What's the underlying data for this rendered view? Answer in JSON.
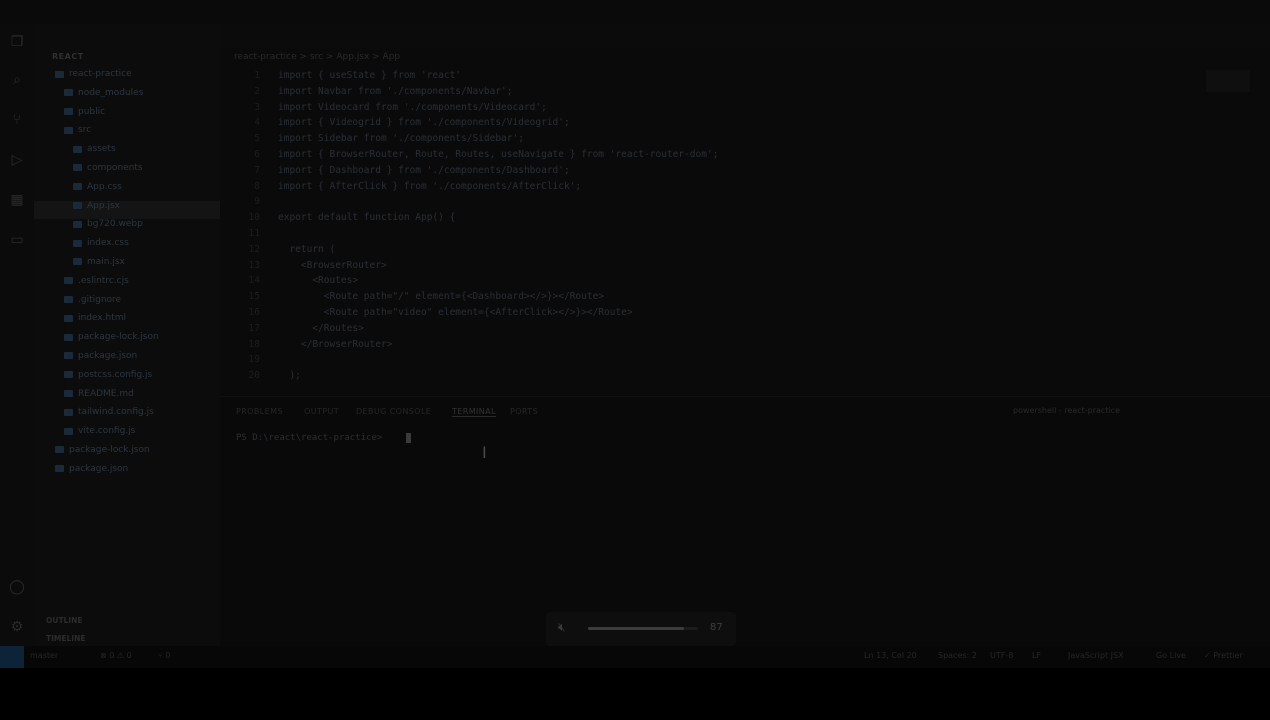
{
  "sidebar": {
    "header": "REACT",
    "tree": [
      {
        "label": "react-practice",
        "indent": 1
      },
      {
        "label": "node_modules",
        "indent": 2
      },
      {
        "label": "public",
        "indent": 2
      },
      {
        "label": "src",
        "indent": 2
      },
      {
        "label": "assets",
        "indent": 3
      },
      {
        "label": "components",
        "indent": 3
      },
      {
        "label": "App.css",
        "indent": 3
      },
      {
        "label": "App.jsx",
        "indent": 3,
        "selected": true
      },
      {
        "label": "bg720.webp",
        "indent": 3
      },
      {
        "label": "index.css",
        "indent": 3
      },
      {
        "label": "main.jsx",
        "indent": 3
      },
      {
        "label": ".eslintrc.cjs",
        "indent": 2
      },
      {
        "label": ".gitignore",
        "indent": 2
      },
      {
        "label": "index.html",
        "indent": 2
      },
      {
        "label": "package-lock.json",
        "indent": 2
      },
      {
        "label": "package.json",
        "indent": 2
      },
      {
        "label": "postcss.config.js",
        "indent": 2
      },
      {
        "label": "README.md",
        "indent": 2
      },
      {
        "label": "tailwind.config.js",
        "indent": 2
      },
      {
        "label": "vite.config.js",
        "indent": 2
      },
      {
        "label": "package-lock.json",
        "indent": 1
      },
      {
        "label": "package.json",
        "indent": 1
      }
    ],
    "outline": "OUTLINE",
    "timeline": "TIMELINE"
  },
  "editor": {
    "breadcrumb": "react-practice > src > App.jsx > App",
    "lines": [
      {
        "n": "1",
        "t": "import { useState } from 'react'"
      },
      {
        "n": "2",
        "t": "import Navbar from './components/Navbar';"
      },
      {
        "n": "3",
        "t": "import Videocard from './components/Videocard';"
      },
      {
        "n": "4",
        "t": "import { Videogrid } from './components/Videogrid';"
      },
      {
        "n": "5",
        "t": "import Sidebar from './components/Sidebar';"
      },
      {
        "n": "6",
        "t": "import { BrowserRouter, Route, Routes, useNavigate } from 'react-router-dom';"
      },
      {
        "n": "7",
        "t": "import { Dashboard } from './components/Dashboard';"
      },
      {
        "n": "8",
        "t": "import { AfterClick } from './components/AfterClick';"
      },
      {
        "n": "9",
        "t": ""
      },
      {
        "n": "10",
        "t": "export default function App() {"
      },
      {
        "n": "11",
        "t": ""
      },
      {
        "n": "12",
        "t": "  return ("
      },
      {
        "n": "13",
        "t": "    <BrowserRouter>"
      },
      {
        "n": "14",
        "t": "      <Routes>"
      },
      {
        "n": "15",
        "t": "        <Route path=\"/\" element={<Dashboard></>}></Route>"
      },
      {
        "n": "16",
        "t": "        <Route path=\"video\" element={<AfterClick></>}></Route>"
      },
      {
        "n": "17",
        "t": "      </Routes>"
      },
      {
        "n": "18",
        "t": "    </BrowserRouter>"
      },
      {
        "n": "19",
        "t": ""
      },
      {
        "n": "20",
        "t": "  );"
      }
    ]
  },
  "panel": {
    "tabs": [
      "PROBLEMS",
      "OUTPUT",
      "DEBUG CONSOLE",
      "TERMINAL",
      "PORTS"
    ],
    "active_tab": "TERMINAL",
    "shell": "powershell - react-practice",
    "prompt": "PS D:\\react\\react-practice>"
  },
  "status": {
    "branch": "master",
    "errors": "⊗ 0 ⚠ 0",
    "ports": "⑂ 0",
    "position": "Ln 13, Col 20",
    "spaces": "Spaces: 2",
    "encoding": "UTF-8",
    "eol": "LF",
    "language": "JavaScript JSX",
    "golive": "Go Live",
    "prettier": "✓ Prettier"
  },
  "volume": {
    "value": "87",
    "fraction": 0.87
  },
  "icons": {
    "explorer": "files-icon",
    "search": "search-icon",
    "scm": "source-control-icon",
    "debug": "debug-icon",
    "extensions": "extensions-icon",
    "remote": "remote-explorer-icon",
    "account": "account-icon",
    "settings": "gear-icon",
    "volume": "speaker-muted-icon"
  }
}
